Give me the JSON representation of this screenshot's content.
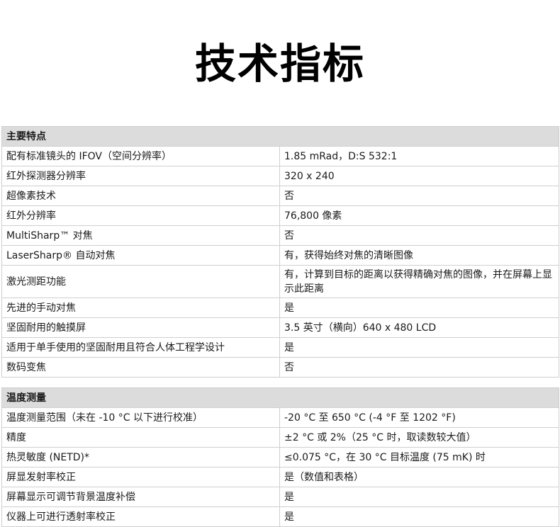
{
  "page_title": "技术指标",
  "sections": [
    {
      "heading": "主要特点",
      "rows": [
        {
          "label": "配有标准镜头的 IFOV（空间分辨率）",
          "value": "1.85 mRad，D:S 532:1"
        },
        {
          "label": "红外探测器分辨率",
          "value": "320 x 240"
        },
        {
          "label": "超像素技术",
          "value": "否"
        },
        {
          "label": "红外分辨率",
          "value": "76,800 像素"
        },
        {
          "label": "MultiSharp™ 对焦",
          "value": "否"
        },
        {
          "label": "LaserSharp® 自动对焦",
          "value": "有，获得始终对焦的清晰图像"
        },
        {
          "label": "激光测距功能",
          "value": "有，计算到目标的距离以获得精确对焦的图像，并在屏幕上显示此距离"
        },
        {
          "label": "先进的手动对焦",
          "value": "是"
        },
        {
          "label": "坚固耐用的触摸屏",
          "value": "3.5 英寸（横向）640 x 480 LCD"
        },
        {
          "label": "适用于单手使用的坚固耐用且符合人体工程学设计",
          "value": "是"
        },
        {
          "label": "数码变焦",
          "value": "否"
        }
      ]
    },
    {
      "heading": "温度测量",
      "rows": [
        {
          "label": "温度测量范围（未在 -10 °C 以下进行校准）",
          "value": "-20 °C 至 650 °C (-4 °F 至 1202 °F)"
        },
        {
          "label": "精度",
          "value": "±2 °C 或 2%（25 °C 时，取读数较大值）"
        },
        {
          "label": "热灵敏度 (NETD)*",
          "value": "≤0.075 °C，在 30 °C 目标温度 (75 mK) 时"
        },
        {
          "label": "屏显发射率校正",
          "value": "是（数值和表格）"
        },
        {
          "label": "屏幕显示可调节背景温度补偿",
          "value": "是"
        },
        {
          "label": "仪器上可进行透射率校正",
          "value": "是"
        }
      ]
    }
  ]
}
